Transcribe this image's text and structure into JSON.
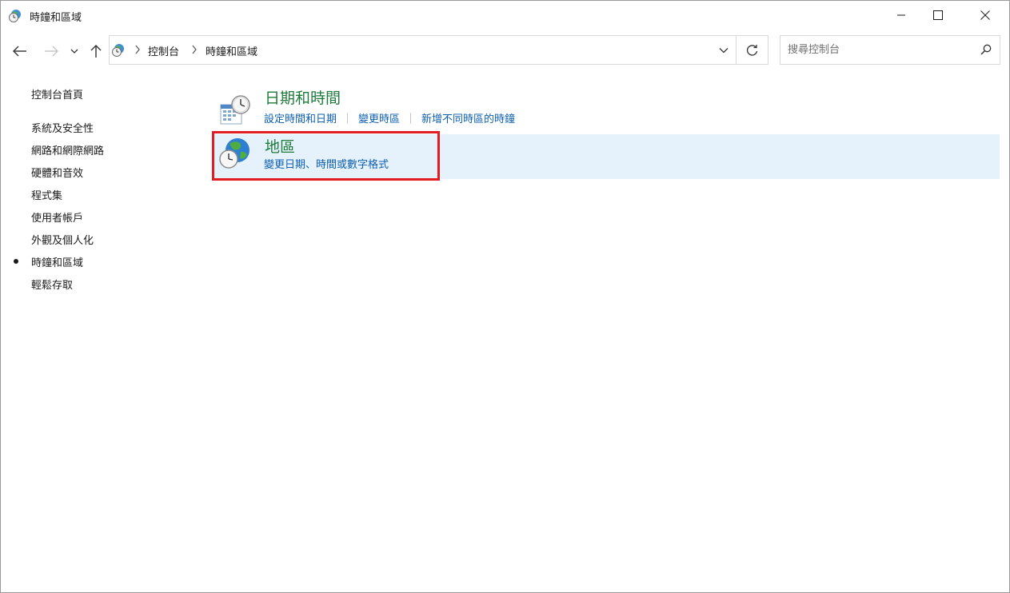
{
  "window": {
    "title": "時鐘和區域"
  },
  "address_bar": {
    "breadcrumbs": [
      "控制台",
      "時鐘和區域"
    ]
  },
  "search": {
    "placeholder": "搜尋控制台"
  },
  "sidebar": {
    "home_label": "控制台首頁",
    "items": [
      {
        "label": "系統及安全性",
        "active": false
      },
      {
        "label": "網路和網際網路",
        "active": false
      },
      {
        "label": "硬體和音效",
        "active": false
      },
      {
        "label": "程式集",
        "active": false
      },
      {
        "label": "使用者帳戶",
        "active": false
      },
      {
        "label": "外觀及個人化",
        "active": false
      },
      {
        "label": "時鐘和區域",
        "active": true
      },
      {
        "label": "輕鬆存取",
        "active": false
      }
    ]
  },
  "categories": [
    {
      "title": "日期和時間",
      "links": [
        "設定時間和日期",
        "變更時區",
        "新增不同時區的時鐘"
      ]
    },
    {
      "title": "地區",
      "links": [
        "變更日期、時間或數字格式"
      ]
    }
  ],
  "colors": {
    "category_title": "#1e7b3b",
    "link": "#0e5fb0",
    "highlight_bg": "#e5f1fb",
    "annotation_box": "#e31b23"
  }
}
